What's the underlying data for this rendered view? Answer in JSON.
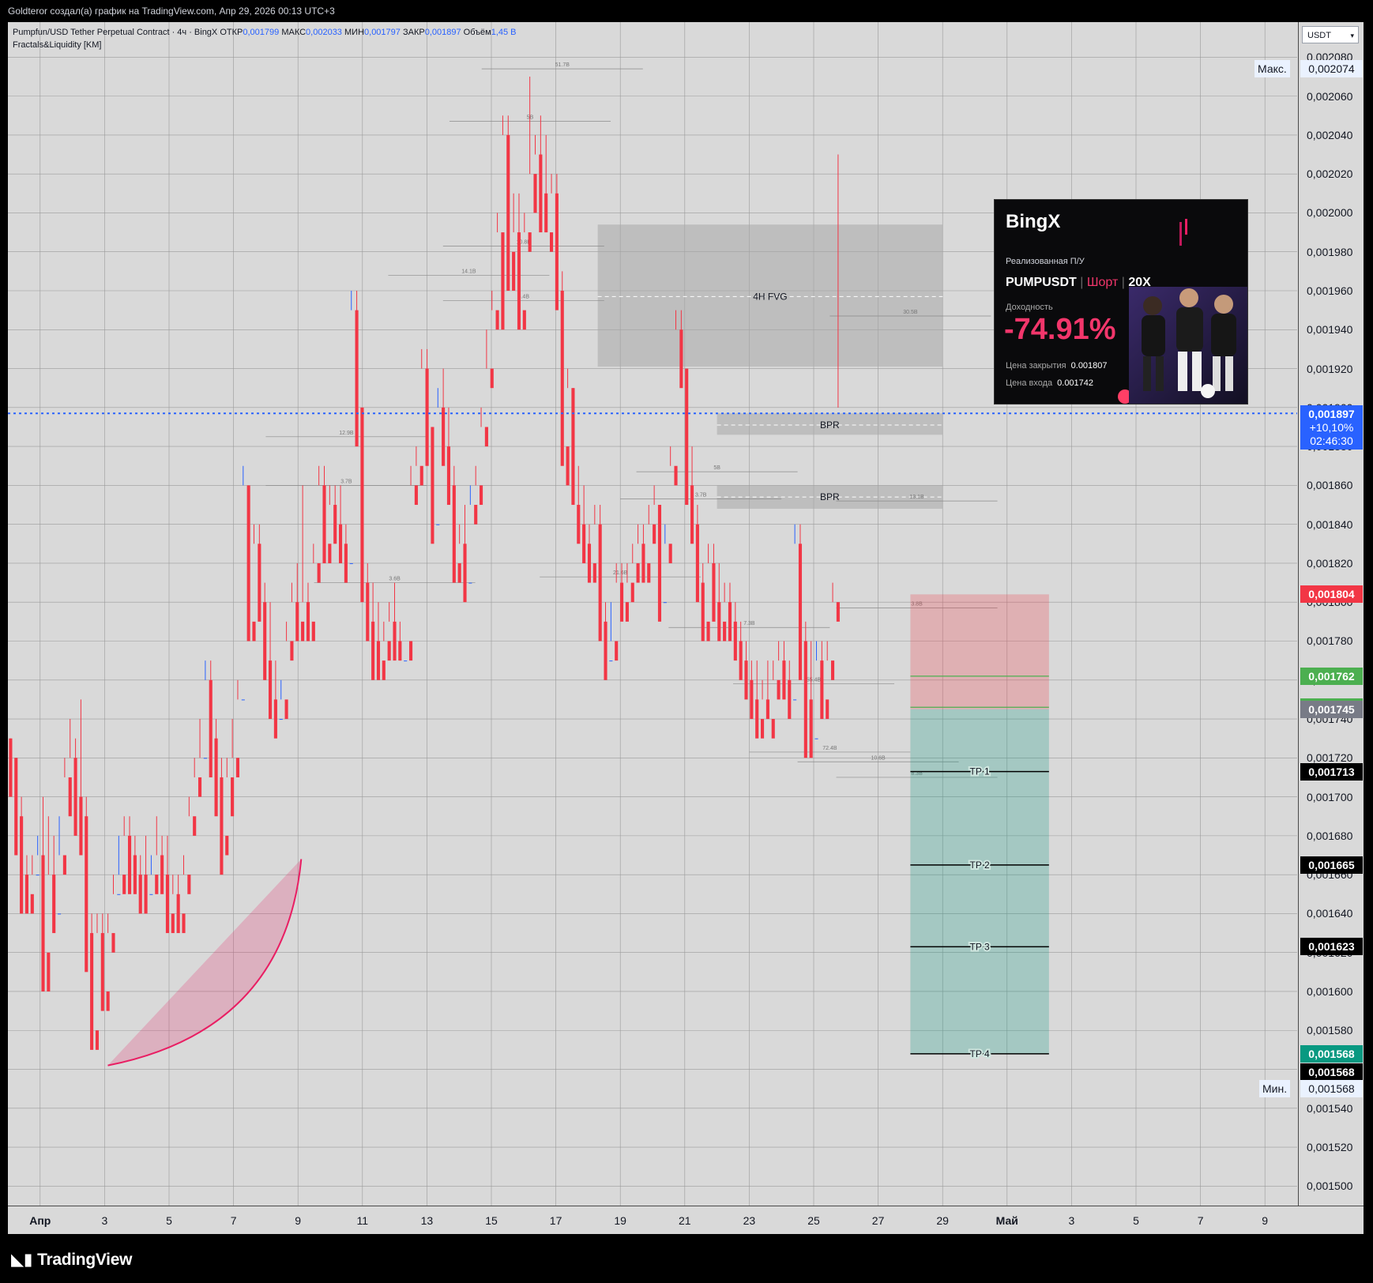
{
  "header": {
    "caption": "Goldteror создал(а) график на TradingView.com, Апр 29, 2026 00:13 UTC+3"
  },
  "legend": {
    "symbol": "Pumpfun/USD Tether Perpetual Contract · 4ч · BingX",
    "open_label": "ОТКР",
    "open": "0,001799",
    "high_label": "МАКС",
    "high": "0,002033",
    "low_label": "МИН",
    "low": "0,001797",
    "close_label": "ЗАКР",
    "close": "0,001897",
    "vol_label": "Объём",
    "vol": "1,45 B",
    "indicator": "Fractals&Liquidity [KM]"
  },
  "axis": {
    "currency": "USDT",
    "max_label": "Макс.",
    "max_value": "0,002074",
    "min_label": "Мин.",
    "min_value": "0,001568",
    "current": {
      "price": "0,001897",
      "change": "+10,10%",
      "timer": "02:46:30"
    }
  },
  "price_tags": [
    {
      "value": 0.001804,
      "text": "0,001804",
      "color": "#f23645"
    },
    {
      "value": 0.001762,
      "text": "0,001762",
      "color": "#4caf50"
    },
    {
      "value": 0.001746,
      "text": "0,001746",
      "color": "#4caf50"
    },
    {
      "value": 0.001745,
      "text": "0,001745",
      "color": "#787b86"
    },
    {
      "value": 0.001713,
      "text": "0,001713",
      "color": "#000000"
    },
    {
      "value": 0.001665,
      "text": "0,001665",
      "color": "#000000"
    },
    {
      "value": 0.001623,
      "text": "0,001623",
      "color": "#000000"
    },
    {
      "value": 0.001568,
      "text": "0,001568",
      "color": "#089981"
    },
    {
      "value": 0.0015675,
      "text": "0,001568",
      "color": "#000000"
    }
  ],
  "promo": {
    "brand": "BingX",
    "realized_label": "Реализованная П/У",
    "pair": "PUMPUSDT",
    "side": "Шорт",
    "leverage": "20X",
    "yield_label": "Доходность",
    "yield": "-74.91%",
    "close_label": "Цена закрытия",
    "close_price": "0.001807",
    "entry_label": "Цена входа",
    "entry_price": "0.001742"
  },
  "footer": {
    "brand": "TradingView"
  },
  "chart_data": {
    "type": "candlestick",
    "timeframe": "4h",
    "ylim": [
      0.00149,
      0.002098
    ],
    "y_ticks": [
      "0,001500",
      "0,001520",
      "0,001540",
      "0,001560",
      "0,001580",
      "0,001600",
      "0,001620",
      "0,001640",
      "0,001660",
      "0,001680",
      "0,001700",
      "0,001720",
      "0,001740",
      "0,001760",
      "0,001780",
      "0,001800",
      "0,001820",
      "0,001840",
      "0,001860",
      "0,001880",
      "0,001900",
      "0,001920",
      "0,001940",
      "0,001960",
      "0,001980",
      "0,002000",
      "0,002020",
      "0,002040",
      "0,002060",
      "0,002080"
    ],
    "x_labels": [
      "Апр",
      "3",
      "5",
      "7",
      "9",
      "11",
      "13",
      "15",
      "17",
      "19",
      "21",
      "23",
      "25",
      "27",
      "29",
      "Май",
      "3",
      "5",
      "7",
      "9"
    ],
    "x_label_bold": [
      "Апр",
      "Май"
    ],
    "x_day_range": [
      0,
      40
    ],
    "x_label_days": [
      1,
      3,
      5,
      7,
      9,
      11,
      13,
      15,
      17,
      19,
      21,
      23,
      25,
      27,
      29,
      31,
      33,
      35,
      37,
      39
    ],
    "candles": [
      [
        0.00173,
        0.00173,
        0.00171,
        0.0017
      ],
      [
        0.00172,
        0.00172,
        0.00169,
        0.00167
      ],
      [
        0.00169,
        0.0017,
        0.00166,
        0.00164
      ],
      [
        0.00166,
        0.00167,
        0.00165,
        0.00164
      ],
      [
        0.00165,
        0.00167,
        0.00166,
        0.00164
      ],
      [
        0.00166,
        0.00168,
        0.00167,
        0.00166
      ],
      [
        0.00167,
        0.0017,
        0.00162,
        0.0016
      ],
      [
        0.00162,
        0.00169,
        0.00166,
        0.0016
      ],
      [
        0.00166,
        0.00168,
        0.00164,
        0.00163
      ],
      [
        0.00164,
        0.00169,
        0.00167,
        0.00164
      ],
      [
        0.00167,
        0.00172,
        0.00171,
        0.00166
      ],
      [
        0.00171,
        0.00174,
        0.00172,
        0.00169
      ],
      [
        0.00172,
        0.00173,
        0.0017,
        0.00168
      ],
      [
        0.0017,
        0.00175,
        0.00169,
        0.00167
      ],
      [
        0.00169,
        0.0017,
        0.00163,
        0.00161
      ],
      [
        0.00163,
        0.00164,
        0.00158,
        0.00157
      ],
      [
        0.00158,
        0.00164,
        0.00163,
        0.00157
      ],
      [
        0.00163,
        0.00164,
        0.0016,
        0.00159
      ],
      [
        0.0016,
        0.00164,
        0.00163,
        0.00159
      ],
      [
        0.00163,
        0.00166,
        0.00165,
        0.00162
      ],
      [
        0.00165,
        0.00168,
        0.00166,
        0.00165
      ],
      [
        0.00166,
        0.00169,
        0.00168,
        0.00165
      ],
      [
        0.00168,
        0.00169,
        0.00167,
        0.00165
      ],
      [
        0.00167,
        0.00168,
        0.00166,
        0.00165
      ],
      [
        0.00166,
        0.00167,
        0.00166,
        0.00164
      ],
      [
        0.00166,
        0.00168,
        0.00165,
        0.00164
      ],
      [
        0.00165,
        0.00167,
        0.00166,
        0.00165
      ],
      [
        0.00166,
        0.00169,
        0.00167,
        0.00165
      ],
      [
        0.00167,
        0.00168,
        0.00166,
        0.00165
      ],
      [
        0.00166,
        0.00168,
        0.00164,
        0.00163
      ],
      [
        0.00164,
        0.00166,
        0.00165,
        0.00163
      ],
      [
        0.00165,
        0.00166,
        0.00164,
        0.00163
      ],
      [
        0.00164,
        0.00167,
        0.00166,
        0.00163
      ],
      [
        0.00166,
        0.0017,
        0.00169,
        0.00165
      ],
      [
        0.00169,
        0.00172,
        0.00171,
        0.00168
      ],
      [
        0.00171,
        0.00174,
        0.00172,
        0.0017
      ],
      [
        0.00172,
        0.00177,
        0.00176,
        0.00172
      ],
      [
        0.00176,
        0.00177,
        0.00173,
        0.00171
      ],
      [
        0.00173,
        0.00174,
        0.00171,
        0.00169
      ],
      [
        0.00171,
        0.00172,
        0.00168,
        0.00166
      ],
      [
        0.00168,
        0.00172,
        0.00171,
        0.00167
      ],
      [
        0.00171,
        0.00174,
        0.00172,
        0.00169
      ],
      [
        0.00172,
        0.00176,
        0.00175,
        0.00171
      ],
      [
        0.00175,
        0.00187,
        0.00186,
        0.00175
      ],
      [
        0.00186,
        0.00186,
        0.00179,
        0.00178
      ],
      [
        0.00179,
        0.00184,
        0.00183,
        0.00178
      ],
      [
        0.00183,
        0.00184,
        0.0018,
        0.00179
      ],
      [
        0.0018,
        0.00181,
        0.00177,
        0.00176
      ],
      [
        0.00177,
        0.0018,
        0.00175,
        0.00174
      ],
      [
        0.00175,
        0.00177,
        0.00174,
        0.00173
      ],
      [
        0.00174,
        0.00176,
        0.00175,
        0.00174
      ],
      [
        0.00175,
        0.00179,
        0.00178,
        0.00174
      ],
      [
        0.00178,
        0.00181,
        0.0018,
        0.00177
      ],
      [
        0.0018,
        0.00182,
        0.00179,
        0.00178
      ],
      [
        0.00179,
        0.00186,
        0.0018,
        0.00178
      ],
      [
        0.0018,
        0.00181,
        0.00179,
        0.00178
      ],
      [
        0.00179,
        0.00183,
        0.00182,
        0.00178
      ],
      [
        0.00182,
        0.00187,
        0.00186,
        0.00181
      ],
      [
        0.00186,
        0.00187,
        0.00183,
        0.00182
      ],
      [
        0.00183,
        0.00186,
        0.00185,
        0.00182
      ],
      [
        0.00185,
        0.00186,
        0.00184,
        0.00183
      ],
      [
        0.00184,
        0.00186,
        0.00183,
        0.00182
      ],
      [
        0.00183,
        0.00184,
        0.00182,
        0.00181
      ],
      [
        0.00182,
        0.00196,
        0.00195,
        0.00182
      ],
      [
        0.00195,
        0.00196,
        0.0019,
        0.00188
      ],
      [
        0.0019,
        0.0019,
        0.00181,
        0.0018
      ],
      [
        0.00181,
        0.00182,
        0.00179,
        0.00178
      ],
      [
        0.00179,
        0.00181,
        0.00178,
        0.00176
      ],
      [
        0.00178,
        0.0018,
        0.00177,
        0.00176
      ],
      [
        0.00177,
        0.00179,
        0.00178,
        0.00176
      ],
      [
        0.00178,
        0.0018,
        0.00179,
        0.00177
      ],
      [
        0.00179,
        0.00181,
        0.00178,
        0.00177
      ],
      [
        0.00178,
        0.00179,
        0.00177,
        0.00177
      ],
      [
        0.00177,
        0.00178,
        0.00178,
        0.00177
      ],
      [
        0.00178,
        0.00187,
        0.00186,
        0.00177
      ],
      [
        0.00186,
        0.00188,
        0.00187,
        0.00185
      ],
      [
        0.00187,
        0.00193,
        0.00192,
        0.00186
      ],
      [
        0.00192,
        0.00193,
        0.00189,
        0.00187
      ],
      [
        0.00189,
        0.00189,
        0.00184,
        0.00183
      ],
      [
        0.00184,
        0.00191,
        0.0019,
        0.00184
      ],
      [
        0.0019,
        0.00192,
        0.00188,
        0.00187
      ],
      [
        0.00188,
        0.0019,
        0.00186,
        0.00185
      ],
      [
        0.00186,
        0.00187,
        0.00182,
        0.00181
      ],
      [
        0.00182,
        0.00184,
        0.00183,
        0.00181
      ],
      [
        0.00183,
        0.00185,
        0.00181,
        0.0018
      ],
      [
        0.00181,
        0.00186,
        0.00185,
        0.00181
      ],
      [
        0.00185,
        0.00187,
        0.00186,
        0.00184
      ],
      [
        0.00186,
        0.0019,
        0.00189,
        0.00185
      ],
      [
        0.00189,
        0.00194,
        0.00192,
        0.00188
      ],
      [
        0.00192,
        0.00196,
        0.00195,
        0.00191
      ],
      [
        0.00195,
        0.002,
        0.00199,
        0.00194
      ],
      [
        0.00199,
        0.00205,
        0.00204,
        0.00194
      ],
      [
        0.00204,
        0.00205,
        0.00198,
        0.00196
      ],
      [
        0.00198,
        0.00201,
        0.00199,
        0.00196
      ],
      [
        0.00199,
        0.00201,
        0.00195,
        0.00194
      ],
      [
        0.00195,
        0.002,
        0.00199,
        0.00194
      ],
      [
        0.00199,
        0.00207,
        0.00202,
        0.00198
      ],
      [
        0.00202,
        0.00204,
        0.00203,
        0.002
      ],
      [
        0.00203,
        0.00205,
        0.00201,
        0.00199
      ],
      [
        0.00201,
        0.00204,
        0.00199,
        0.00199
      ],
      [
        0.00199,
        0.00202,
        0.00201,
        0.00198
      ],
      [
        0.00201,
        0.00202,
        0.00196,
        0.00195
      ],
      [
        0.00196,
        0.00197,
        0.00188,
        0.00187
      ],
      [
        0.00188,
        0.00192,
        0.00191,
        0.00186
      ],
      [
        0.00191,
        0.00191,
        0.00185,
        0.00185
      ],
      [
        0.00185,
        0.00187,
        0.00184,
        0.00183
      ],
      [
        0.00184,
        0.00186,
        0.00183,
        0.00182
      ],
      [
        0.00183,
        0.00184,
        0.00182,
        0.00181
      ],
      [
        0.00182,
        0.00185,
        0.00184,
        0.00181
      ],
      [
        0.00184,
        0.00185,
        0.00179,
        0.00178
      ],
      [
        0.00179,
        0.0018,
        0.00177,
        0.00176
      ],
      [
        0.00177,
        0.0018,
        0.00178,
        0.00177
      ],
      [
        0.00178,
        0.00182,
        0.00181,
        0.00177
      ],
      [
        0.00181,
        0.00182,
        0.0018,
        0.00179
      ],
      [
        0.0018,
        0.00182,
        0.00181,
        0.00179
      ],
      [
        0.00181,
        0.00183,
        0.00182,
        0.0018
      ],
      [
        0.00182,
        0.00184,
        0.00183,
        0.00181
      ],
      [
        0.00183,
        0.00184,
        0.00182,
        0.00181
      ],
      [
        0.00182,
        0.00185,
        0.00184,
        0.00181
      ],
      [
        0.00184,
        0.00186,
        0.00185,
        0.00183
      ],
      [
        0.00185,
        0.00185,
        0.0018,
        0.00179
      ],
      [
        0.0018,
        0.00184,
        0.00183,
        0.0018
      ],
      [
        0.00183,
        0.00188,
        0.00187,
        0.00182
      ],
      [
        0.00187,
        0.00195,
        0.00194,
        0.00186
      ],
      [
        0.00194,
        0.00195,
        0.00192,
        0.00191
      ],
      [
        0.00192,
        0.00192,
        0.00186,
        0.00185
      ],
      [
        0.00186,
        0.00188,
        0.00184,
        0.00183
      ],
      [
        0.00184,
        0.00185,
        0.00181,
        0.0018
      ],
      [
        0.00181,
        0.00182,
        0.00179,
        0.00178
      ],
      [
        0.00179,
        0.00183,
        0.00182,
        0.00178
      ],
      [
        0.00182,
        0.00183,
        0.0018,
        0.00179
      ],
      [
        0.0018,
        0.00182,
        0.00179,
        0.00178
      ],
      [
        0.00179,
        0.00181,
        0.0018,
        0.00178
      ],
      [
        0.0018,
        0.00181,
        0.00179,
        0.00178
      ],
      [
        0.00179,
        0.0018,
        0.00178,
        0.00177
      ],
      [
        0.00178,
        0.00179,
        0.00177,
        0.00176
      ],
      [
        0.00177,
        0.00178,
        0.00176,
        0.00175
      ],
      [
        0.00176,
        0.00177,
        0.00175,
        0.00174
      ],
      [
        0.00175,
        0.00177,
        0.00174,
        0.00173
      ],
      [
        0.00174,
        0.00176,
        0.00175,
        0.00173
      ],
      [
        0.00175,
        0.00177,
        0.00174,
        0.00174
      ],
      [
        0.00174,
        0.00177,
        0.00176,
        0.00173
      ],
      [
        0.00176,
        0.00178,
        0.00177,
        0.00175
      ],
      [
        0.00177,
        0.00178,
        0.00176,
        0.00175
      ],
      [
        0.00176,
        0.00177,
        0.00175,
        0.00174
      ],
      [
        0.00175,
        0.00184,
        0.00183,
        0.00175
      ],
      [
        0.00183,
        0.00184,
        0.00178,
        0.00176
      ],
      [
        0.00178,
        0.00179,
        0.00175,
        0.00172
      ],
      [
        0.00175,
        0.00178,
        0.00173,
        0.00172
      ],
      [
        0.00173,
        0.00178,
        0.00177,
        0.00173
      ],
      [
        0.00177,
        0.00178,
        0.00175,
        0.00174
      ],
      [
        0.00175,
        0.00178,
        0.00177,
        0.00174
      ],
      [
        0.00177,
        0.00181,
        0.0018,
        0.00176
      ],
      [
        0.0018,
        0.00203,
        0.0019,
        0.00179
      ]
    ],
    "candle_x_start": 0.0,
    "candle_step_days": 0.1678,
    "colors": {
      "up": "#2962ff",
      "down": "#f23645"
    },
    "current_price": 0.001897,
    "zones": [
      {
        "label": "4H FVG",
        "day_from": 18.3,
        "day_to": 29.0,
        "top": 0.001994,
        "bottom": 0.001921,
        "mid": 0.001957
      },
      {
        "label": "BPR",
        "day_from": 22.0,
        "day_to": 29.0,
        "top": 0.001897,
        "bottom": 0.001886,
        "mid": 0.001891
      },
      {
        "label": "BPR",
        "day_from": 22.0,
        "day_to": 29.0,
        "top": 0.00186,
        "bottom": 0.001848,
        "mid": 0.001854
      }
    ],
    "position": {
      "side": "short",
      "day_from": 28.0,
      "day_to": 32.3,
      "stop": 0.001804,
      "entry": 0.001745,
      "entry_line": 0.001746,
      "tp_line": 0.001762,
      "target": 0.001568,
      "take_profits": [
        {
          "label": "TP 1",
          "value": 0.001713
        },
        {
          "label": "TP 2",
          "value": 0.001665
        },
        {
          "label": "TP 3",
          "value": 0.001623
        },
        {
          "label": "TP 4",
          "value": 0.001568
        }
      ]
    },
    "liquidity_levels": [
      {
        "day": 17.2,
        "value": 0.002074,
        "text": "51.7B"
      },
      {
        "day": 16.2,
        "value": 0.002047,
        "text": "5B"
      },
      {
        "day": 16.0,
        "value": 0.001983,
        "text": "10.8B"
      },
      {
        "day": 14.3,
        "value": 0.001968,
        "text": "14.1B"
      },
      {
        "day": 16.0,
        "value": 0.001955,
        "text": "3.4B"
      },
      {
        "day": 28.0,
        "value": 0.001947,
        "text": "30.5B"
      },
      {
        "day": 10.5,
        "value": 0.001885,
        "text": "12.9B"
      },
      {
        "day": 10.5,
        "value": 0.00186,
        "text": "3.7B"
      },
      {
        "day": 22.0,
        "value": 0.001867,
        "text": "5B"
      },
      {
        "day": 21.5,
        "value": 0.001853,
        "text": "3.7B"
      },
      {
        "day": 12.0,
        "value": 0.00181,
        "text": "3.6B"
      },
      {
        "day": 19.0,
        "value": 0.001813,
        "text": "21.6B"
      },
      {
        "day": 23.0,
        "value": 0.001787,
        "text": "7.3B"
      },
      {
        "day": 25.0,
        "value": 0.001758,
        "text": "55.4B"
      },
      {
        "day": 25.5,
        "value": 0.001723,
        "text": "72.4B"
      },
      {
        "day": 27.0,
        "value": 0.001718,
        "text": "10.6B"
      },
      {
        "day": 28.2,
        "value": 0.00171,
        "text": "8.3B"
      },
      {
        "day": 28.2,
        "value": 0.001797,
        "text": "3.8B"
      },
      {
        "day": 28.2,
        "value": 0.001852,
        "text": "13.1B"
      }
    ]
  }
}
